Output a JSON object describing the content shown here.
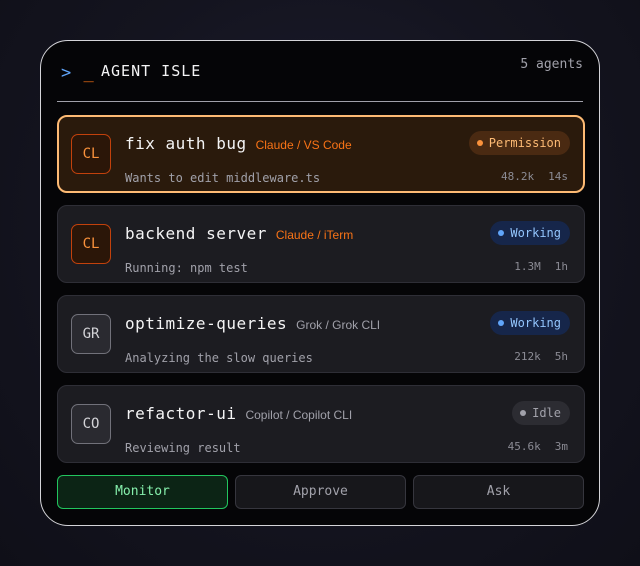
{
  "header": {
    "prompt_symbol": ">",
    "cursor_symbol": "_",
    "title": "AGENT ISLE",
    "agent_count": "5 agents"
  },
  "agents": [
    {
      "initials": "CL",
      "name": "fix auth bug",
      "source": "Claude / VS Code",
      "detail": "Wants to edit middleware.ts",
      "status": "Permission",
      "tokens": "48.2k",
      "time": "14s"
    },
    {
      "initials": "CL",
      "name": "backend server",
      "source": "Claude / iTerm",
      "detail": "Running: npm test",
      "status": "Working",
      "tokens": "1.3M",
      "time": "1h"
    },
    {
      "initials": "GR",
      "name": "optimize-queries",
      "source": "Grok / Grok CLI",
      "detail": "Analyzing the slow queries",
      "status": "Working",
      "tokens": "212k",
      "time": "5h"
    },
    {
      "initials": "CO",
      "name": "refactor-ui",
      "source": "Copilot / Copilot CLI",
      "detail": "Reviewing result",
      "status": "Idle",
      "tokens": "45.6k",
      "time": "3m"
    }
  ],
  "actions": {
    "monitor": "Monitor",
    "approve": "Approve",
    "ask": "Ask"
  },
  "colors": {
    "accent_orange": "#f97316",
    "working_blue": "#60a5fa",
    "monitor_green": "#22c55e",
    "panel_background": "#050507"
  }
}
